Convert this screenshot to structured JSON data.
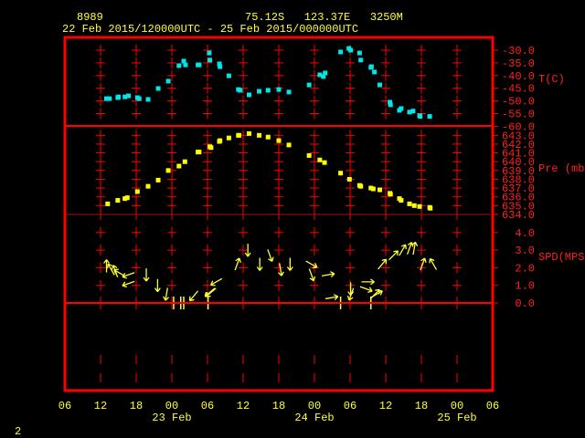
{
  "header": {
    "station_id": "8989",
    "location": "75.12S   123.37E   3250M",
    "time_range": "22 Feb 2015/120000UTC - 25 Feb 2015/000000UTC"
  },
  "footer": {
    "page_number": "2"
  },
  "colors": {
    "frame": "#ff0000",
    "text": "#ffff33",
    "temperature": "#00e5e5",
    "pressure": "#ffff00",
    "wind": "#ffff33"
  },
  "chart_data": {
    "type": "scatter",
    "x_units": "hours since 22 Feb 2015 00UTC",
    "xlim": [
      6,
      78
    ],
    "x_ticks": [
      {
        "h": 6,
        "label": "06"
      },
      {
        "h": 12,
        "label": "12"
      },
      {
        "h": 18,
        "label": "18"
      },
      {
        "h": 24,
        "label": "00"
      },
      {
        "h": 30,
        "label": "06"
      },
      {
        "h": 36,
        "label": "12"
      },
      {
        "h": 42,
        "label": "18"
      },
      {
        "h": 48,
        "label": "00"
      },
      {
        "h": 54,
        "label": "06"
      },
      {
        "h": 60,
        "label": "12"
      },
      {
        "h": 66,
        "label": "18"
      },
      {
        "h": 72,
        "label": "00"
      },
      {
        "h": 78,
        "label": "06"
      }
    ],
    "date_labels": [
      {
        "h": 24,
        "label": "23 Feb"
      },
      {
        "h": 48,
        "label": "24 Feb"
      },
      {
        "h": 72,
        "label": "25 Feb"
      }
    ],
    "panels": [
      {
        "name": "temperature",
        "ylabel": "T(C)",
        "ylim": [
          -60,
          -30
        ],
        "ticks": [
          "-30.0",
          "-35.0",
          "-40.0",
          "-45.0",
          "-50.0",
          "-55.0",
          "-60.0"
        ],
        "tick_values": [
          -30,
          -35,
          -40,
          -45,
          -50,
          -55,
          -60
        ],
        "points": [
          [
            13.0,
            -49.1
          ],
          [
            13.5,
            -49.1
          ],
          [
            14.9,
            -48.7
          ],
          [
            15.0,
            -48.4
          ],
          [
            16.1,
            -48.4
          ],
          [
            16.7,
            -48.0
          ],
          [
            18.2,
            -48.7
          ],
          [
            18.5,
            -49.1
          ],
          [
            20.0,
            -49.4
          ],
          [
            21.7,
            -45.1
          ],
          [
            23.4,
            -42.2
          ],
          [
            25.2,
            -36.1
          ],
          [
            26.0,
            -34.3
          ],
          [
            26.3,
            -35.8
          ],
          [
            28.4,
            -35.8
          ],
          [
            28.6,
            -35.8
          ],
          [
            30.3,
            -31.1
          ],
          [
            30.4,
            -33.9
          ],
          [
            32.0,
            -35.4
          ],
          [
            32.1,
            -36.5
          ],
          [
            33.6,
            -40.1
          ],
          [
            35.2,
            -45.5
          ],
          [
            35.5,
            -45.8
          ],
          [
            37.0,
            -47.6
          ],
          [
            38.7,
            -46.2
          ],
          [
            40.2,
            -45.8
          ],
          [
            42.0,
            -45.5
          ],
          [
            43.7,
            -46.5
          ],
          [
            47.1,
            -43.7
          ],
          [
            48.9,
            -39.7
          ],
          [
            49.5,
            -40.4
          ],
          [
            49.8,
            -39.0
          ],
          [
            52.4,
            -30.7
          ],
          [
            53.8,
            -29.3
          ],
          [
            54.1,
            -30.0
          ],
          [
            55.6,
            -31.1
          ],
          [
            55.8,
            -33.9
          ],
          [
            57.5,
            -36.8
          ],
          [
            57.6,
            -36.5
          ],
          [
            58.1,
            -38.6
          ],
          [
            59.0,
            -43.7
          ],
          [
            60.7,
            -50.5
          ],
          [
            60.8,
            -51.5
          ],
          [
            62.3,
            -53.7
          ],
          [
            62.6,
            -53.0
          ],
          [
            64.0,
            -54.4
          ],
          [
            64.6,
            -54.0
          ],
          [
            65.7,
            -55.8
          ],
          [
            65.8,
            -56.1
          ],
          [
            67.4,
            -56.1
          ]
        ]
      },
      {
        "name": "pressure",
        "ylabel": "Pre (mb)",
        "ylim": [
          634,
          643
        ],
        "ticks": [
          "643.0",
          "642.0",
          "641.0",
          "640.0",
          "639.0",
          "638.0",
          "637.0",
          "636.0",
          "635.0",
          "634.0"
        ],
        "tick_values": [
          643,
          642,
          641,
          640,
          639,
          638,
          637,
          636,
          635,
          634
        ],
        "points": [
          [
            13.2,
            635.2
          ],
          [
            14.9,
            635.6
          ],
          [
            16.1,
            635.8
          ],
          [
            16.5,
            635.9
          ],
          [
            18.2,
            636.6
          ],
          [
            20.0,
            637.2
          ],
          [
            21.7,
            637.9
          ],
          [
            23.4,
            639.0
          ],
          [
            25.2,
            639.5
          ],
          [
            26.2,
            640.0
          ],
          [
            28.4,
            641.1
          ],
          [
            28.6,
            641.1
          ],
          [
            30.4,
            641.7
          ],
          [
            30.6,
            641.6
          ],
          [
            32.0,
            642.3
          ],
          [
            32.1,
            642.4
          ],
          [
            33.6,
            642.7
          ],
          [
            35.2,
            643.0
          ],
          [
            35.3,
            643.0
          ],
          [
            37.0,
            643.2
          ],
          [
            38.7,
            643.0
          ],
          [
            40.2,
            642.8
          ],
          [
            42.0,
            642.4
          ],
          [
            43.7,
            641.9
          ],
          [
            47.1,
            640.7
          ],
          [
            48.9,
            640.2
          ],
          [
            49.7,
            639.9
          ],
          [
            52.4,
            638.7
          ],
          [
            53.9,
            638.0
          ],
          [
            55.6,
            637.3
          ],
          [
            55.8,
            637.2
          ],
          [
            57.5,
            637.0
          ],
          [
            57.9,
            636.9
          ],
          [
            59.0,
            636.8
          ],
          [
            60.7,
            636.4
          ],
          [
            60.8,
            636.3
          ],
          [
            62.3,
            635.8
          ],
          [
            62.6,
            635.6
          ],
          [
            64.0,
            635.2
          ],
          [
            64.8,
            635.0
          ],
          [
            65.7,
            634.9
          ],
          [
            67.4,
            634.8
          ],
          [
            67.5,
            634.7
          ]
        ]
      },
      {
        "name": "wind_speed",
        "ylabel": "SPD(MPS)",
        "ylim": [
          0,
          4
        ],
        "ticks": [
          "4.0",
          "3.0",
          "2.0",
          "1.0",
          "0.0"
        ],
        "tick_values": [
          4,
          3,
          2,
          1,
          0
        ],
        "points_note": "[hour, speed m/s, arrow heading degrees (0=up)]; speed 0 = calm",
        "points": [
          [
            13.0,
            2.1,
            0
          ],
          [
            13.8,
            1.9,
            330
          ],
          [
            14.5,
            1.8,
            340
          ],
          [
            15.2,
            1.7,
            300
          ],
          [
            16.7,
            1.6,
            250
          ],
          [
            16.7,
            1.1,
            250
          ],
          [
            19.7,
            1.6,
            180
          ],
          [
            21.6,
            1.0,
            180
          ],
          [
            23.1,
            0.5,
            190
          ],
          [
            24.3,
            0,
            0
          ],
          [
            25.5,
            0,
            0
          ],
          [
            26.0,
            0,
            0
          ],
          [
            27.7,
            0.4,
            220
          ],
          [
            30.4,
            0.6,
            230
          ],
          [
            30.1,
            0,
            0
          ],
          [
            31.5,
            1.2,
            240
          ],
          [
            30.6,
            0.6,
            230
          ],
          [
            35.0,
            2.2,
            20
          ],
          [
            36.8,
            3.0,
            180
          ],
          [
            40.5,
            2.7,
            160
          ],
          [
            38.8,
            2.2,
            180
          ],
          [
            42.3,
            1.9,
            170
          ],
          [
            43.9,
            2.2,
            180
          ],
          [
            47.5,
            2.2,
            120
          ],
          [
            47.5,
            1.6,
            160
          ],
          [
            50.3,
            1.6,
            80
          ],
          [
            50.9,
            0.3,
            80
          ],
          [
            52.4,
            0,
            0
          ],
          [
            54.1,
            0.8,
            180
          ],
          [
            54.2,
            0.5,
            200
          ],
          [
            57.0,
            1.2,
            90
          ],
          [
            56.7,
            0.8,
            110
          ],
          [
            58.2,
            0.5,
            45
          ],
          [
            57.5,
            0,
            0
          ],
          [
            58.5,
            0.5,
            60
          ],
          [
            59.4,
            2.2,
            40
          ],
          [
            61.3,
            2.7,
            45
          ],
          [
            62.8,
            3.0,
            30
          ],
          [
            64.0,
            3.1,
            20
          ],
          [
            64.8,
            3.1,
            10
          ],
          [
            66.2,
            2.2,
            20
          ],
          [
            68.0,
            2.2,
            330
          ]
        ]
      }
    ]
  }
}
